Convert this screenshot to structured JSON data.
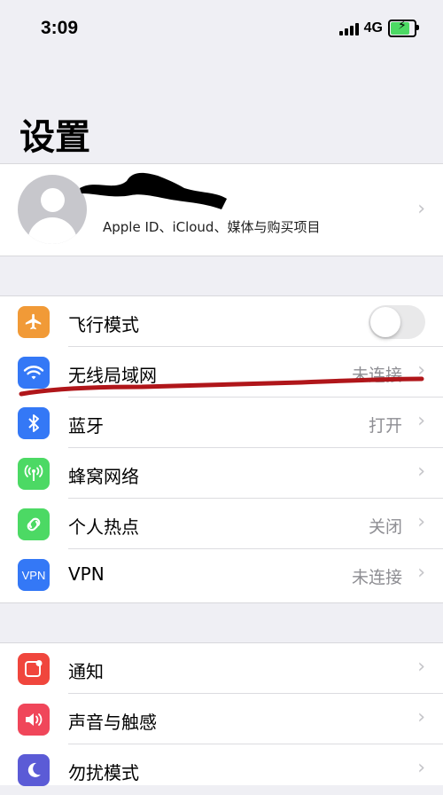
{
  "status_bar": {
    "time": "3:09",
    "network": "4G",
    "battery_level": 0.8,
    "battery_color": "#4cd964"
  },
  "page_title": "设置",
  "profile": {
    "subtitle": "Apple ID、iCloud、媒体与购买项目"
  },
  "network_group": [
    {
      "label": "飞行模式",
      "icon": "airplane-icon",
      "color": "#f19a37",
      "toggle": false
    },
    {
      "label": "无线局域网",
      "icon": "wifi-icon",
      "color": "#3478f6",
      "value": "未连接"
    },
    {
      "label": "蓝牙",
      "icon": "bluetooth-icon",
      "color": "#3478f6",
      "value": "打开"
    },
    {
      "label": "蜂窝网络",
      "icon": "cellular-icon",
      "color": "#4cd964",
      "value": ""
    },
    {
      "label": "个人热点",
      "icon": "hotspot-icon",
      "color": "#4cd964",
      "value": "关闭"
    },
    {
      "label": "VPN",
      "icon": "vpn-icon",
      "icon_text": "VPN",
      "color": "#3478f6",
      "value": "未连接"
    }
  ],
  "notification_group": [
    {
      "label": "通知",
      "icon": "notifications-icon",
      "color": "#f0463d"
    },
    {
      "label": "声音与触感",
      "icon": "sound-icon",
      "color": "#f0465a"
    },
    {
      "label": "勿扰模式",
      "icon": "moon-icon",
      "color": "#5b5bd6"
    }
  ],
  "colors": {
    "background": "#efeff4",
    "annotation_line": "#b0161a"
  }
}
